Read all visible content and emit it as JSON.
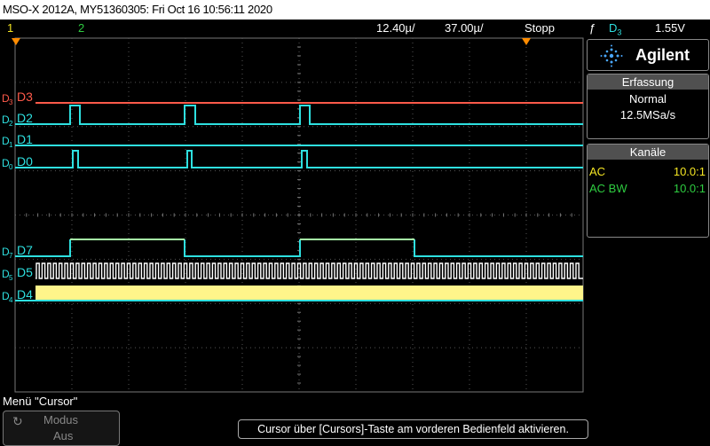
{
  "window_title": "MSO-X 2012A, MY51360305: Fri Oct 16 10:56:11 2020",
  "status": {
    "ch1": "1",
    "ch2": "2",
    "timebase": "12.40µ/",
    "delay": "37.00µ/",
    "run_state": "Stopp",
    "trigger_symbol": "ƒ",
    "trigger_source": "D",
    "trigger_source_sub": "3",
    "trigger_level": "1.55V"
  },
  "brand": "Agilent",
  "acquisition": {
    "title": "Erfassung",
    "mode": "Normal",
    "rate": "12.5MSa/s"
  },
  "channels_panel": {
    "title": "Kanäle",
    "rows": [
      {
        "label": "AC",
        "value": "10.0:1",
        "label_color": "#f5e623",
        "value_color": "#f5e623"
      },
      {
        "label": "AC BW",
        "value": "10.0:1",
        "label_color": "#2ecc40",
        "value_color": "#2ecc40"
      }
    ]
  },
  "digital_channels": [
    {
      "key": "D3",
      "prefix": "D",
      "sub": "3",
      "name": "D3",
      "color": "#ff5a4a"
    },
    {
      "key": "D2",
      "prefix": "D",
      "sub": "2",
      "name": "D2",
      "color": "#2ee0e0"
    },
    {
      "key": "D1",
      "prefix": "D",
      "sub": "1",
      "name": "D1",
      "color": "#2ee0e0"
    },
    {
      "key": "D0",
      "prefix": "D",
      "sub": "0",
      "name": "D0",
      "color": "#2ee0e0"
    },
    {
      "key": "D7",
      "prefix": "D",
      "sub": "7",
      "name": "D7",
      "color": "#2ee0e0"
    },
    {
      "key": "D5",
      "prefix": "D",
      "sub": "5",
      "name": "D5",
      "color": "#2ee0e0"
    },
    {
      "key": "D4",
      "prefix": "D",
      "sub": "4",
      "name": "D4",
      "color": "#2ee0e0"
    }
  ],
  "colors": {
    "grid": "#555555",
    "ch1": "#f5e623",
    "ch2": "#2ecc40",
    "trigger_marker": "#ff8c00",
    "d4_fill": "#fff58a",
    "d5_wave": "#ffffff",
    "channel_high": "#a6f5a6"
  },
  "menu": {
    "title": "Menü \"Cursor\"",
    "modus_label": "Modus",
    "modus_value": "Aus",
    "modus_icon": "rotate-knob-icon"
  },
  "hint_text": "Cursor über [Cursors]-Taste am vorderen Bedienfeld aktivieren."
}
